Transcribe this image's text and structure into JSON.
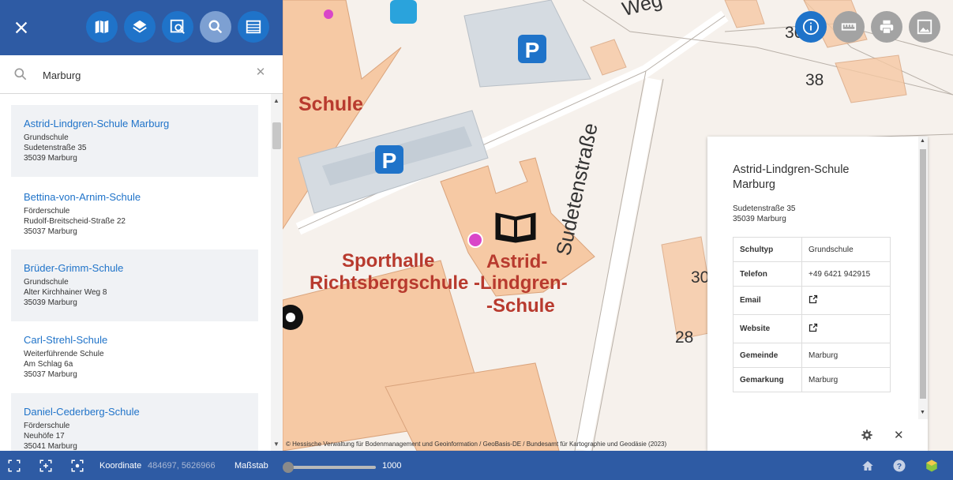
{
  "toolbar": {
    "close_icon": "close-icon",
    "buttons": [
      {
        "name": "map-icon"
      },
      {
        "name": "layers-icon"
      },
      {
        "name": "map-search-icon"
      },
      {
        "name": "search-icon",
        "active": true
      },
      {
        "name": "legend-icon"
      }
    ]
  },
  "search": {
    "value": "Marburg",
    "placeholder": "",
    "clear_label": "✕"
  },
  "results": [
    {
      "title": "Astrid-Lindgren-Schule Marburg",
      "type": "Grundschule",
      "street": "Sudetenstraße 35",
      "city": "35039 Marburg"
    },
    {
      "title": "Bettina-von-Arnim-Schule",
      "type": "Förderschule",
      "street": "Rudolf-Breitscheid-Straße 22",
      "city": "35037 Marburg"
    },
    {
      "title": "Brüder-Grimm-Schule",
      "type": "Grundschule",
      "street": "Alter Kirchhainer Weg 8",
      "city": "35039 Marburg"
    },
    {
      "title": "Carl-Strehl-Schule",
      "type": "Weiterführende Schule",
      "street": "Am Schlag 6a",
      "city": "35037 Marburg"
    },
    {
      "title": "Daniel-Cederberg-Schule",
      "type": "Förderschule",
      "street": "Neuhöfe 17",
      "city": "35041 Marburg"
    }
  ],
  "map": {
    "labels": {
      "schule_top": "Schule",
      "weg": "Weg",
      "sporthalle": "Sporthalle",
      "richtsbergschule": "Richtsbergschule -Lindgren-",
      "astrid": "Astrid-",
      "schule": "-Schule",
      "sudetenstrasse": "Sudetenstraße",
      "num_38": "38",
      "num_30": "30",
      "num_28": "28",
      "num_36": "36"
    },
    "attribution": "© Hessische Verwaltung für Bodenmanagement und Geoinformation / GeoBasis-DE / Bundesamt für Kartographie und Geodäsie (2023)"
  },
  "map_buttons": [
    {
      "name": "info-icon",
      "active": true
    },
    {
      "name": "ruler-icon"
    },
    {
      "name": "print-icon"
    },
    {
      "name": "image-icon"
    }
  ],
  "info": {
    "title": "Astrid-Lindgren-Schule Marburg",
    "street": "Sudetenstraße 35",
    "city": "35039 Marburg",
    "rows": [
      {
        "key": "Schultyp",
        "value": "Grundschule"
      },
      {
        "key": "Telefon",
        "value": "+49 6421 942915"
      },
      {
        "key": "Email",
        "value": "",
        "link": true
      },
      {
        "key": "Website",
        "value": "",
        "link": true
      },
      {
        "key": "Gemeinde",
        "value": "Marburg"
      },
      {
        "key": "Gemarkung",
        "value": "Marburg"
      }
    ],
    "close_label": "✕"
  },
  "footer": {
    "coord_label": "Koordinate",
    "coord_value": "484697, 5626966",
    "scale_label": "Maßstab",
    "scale_value": "1000"
  },
  "colors": {
    "primary": "#2e5ba4",
    "accent": "#1f73c9",
    "building": "#f6c9a4",
    "parking_area": "#d5dbe1"
  }
}
